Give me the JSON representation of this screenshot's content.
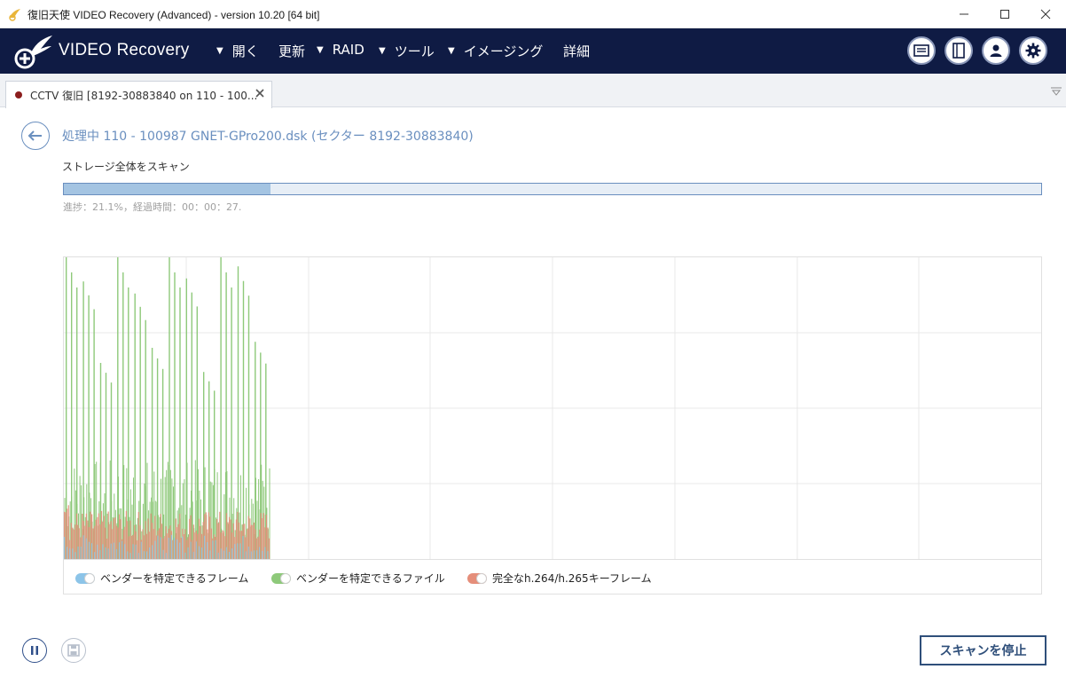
{
  "window": {
    "title": "復旧天使 VIDEO Recovery (Advanced) - version 10.20 [64 bit]",
    "controls": [
      "minimize-icon",
      "maximize-icon",
      "close-icon"
    ]
  },
  "navbar": {
    "brand": "VIDEO Recovery",
    "menu": [
      {
        "label": "開く",
        "caret": "▼"
      },
      {
        "label": "更新",
        "caret": ""
      },
      {
        "label": "RAID",
        "caret": "▼"
      },
      {
        "label": "ツール",
        "caret": "▼"
      },
      {
        "label": "イメージング",
        "caret": "▼"
      },
      {
        "label": "詳細",
        "caret": ""
      }
    ],
    "icons": [
      "message-icon",
      "panel-icon",
      "user-icon",
      "settings-icon"
    ],
    "bg_color": "#0f1b44"
  },
  "tabs": [
    {
      "label": "CCTV 復旧 [8192-30883840 on 110 - 100...",
      "status_color": "#8b1d1d"
    }
  ],
  "main": {
    "processing": "処理中 110 - 100987 GNET-GPro200.dsk (セクター 8192-30883840)",
    "scan_title": "ストレージ全体をスキャン",
    "progress_percent": 21.1,
    "progress_text": "進捗：21.1%，経過時間：00：00：27.",
    "stop_button": "スキャンを停止"
  },
  "chart_data": {
    "type": "bar",
    "title": "",
    "xlabel": "",
    "ylabel": "",
    "grid": true,
    "legend_position": "bottom",
    "series": [
      {
        "name": "ベンダーを特定できるフレーム",
        "color": "#8cc4e8"
      },
      {
        "name": "ベンダーを特定できるファイル",
        "color": "#8ec97a"
      },
      {
        "name": "完全なh.264/h.265キーフレーム",
        "color": "#e58e7a"
      }
    ],
    "bursts": [
      {
        "x": 0,
        "value": 100
      },
      {
        "x": 1,
        "value": 92
      },
      {
        "x": 2,
        "value": 65
      },
      {
        "x": 3,
        "value": 100
      },
      {
        "x": 4,
        "value": 88
      },
      {
        "x": 5,
        "value": 70
      },
      {
        "x": 6,
        "value": 100
      },
      {
        "x": 7,
        "value": 93
      },
      {
        "x": 8,
        "value": 62
      },
      {
        "x": 9,
        "value": 100
      },
      {
        "x": 10,
        "value": 97
      },
      {
        "x": 11,
        "value": 72
      }
    ]
  }
}
